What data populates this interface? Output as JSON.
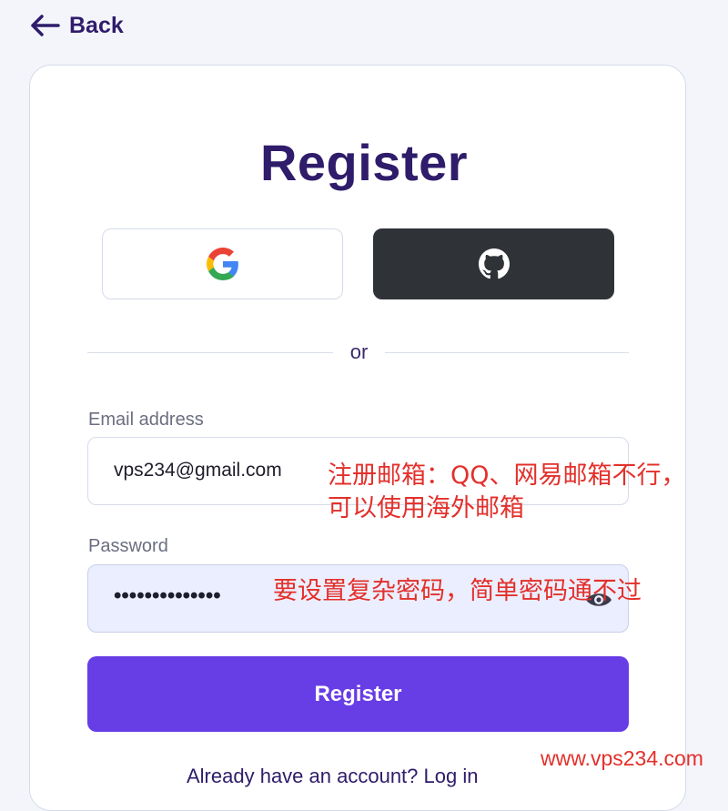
{
  "nav": {
    "back_label": "Back",
    "back_icon": "arrow-left-icon"
  },
  "form": {
    "title": "Register",
    "google_icon": "google-icon",
    "github_icon": "github-icon",
    "divider_text": "or",
    "email": {
      "label": "Email address",
      "value": "vps234@gmail.com"
    },
    "password": {
      "label": "Password",
      "value": "••••••••••••••",
      "toggle_icon": "eye-icon"
    },
    "submit_label": "Register",
    "footer_text": "Already have an account? Log in"
  },
  "annotations": {
    "email_note_line1": "注册邮箱：QQ、网易邮箱不行，",
    "email_note_line2": "可以使用海外邮箱",
    "password_note": "要设置复杂密码，简单密码通不过",
    "watermark": "www.vps234.com"
  },
  "colors": {
    "accent": "#673de6",
    "heading": "#2f1c6a",
    "annotation": "#e3302b",
    "github_bg": "#2f3338"
  }
}
